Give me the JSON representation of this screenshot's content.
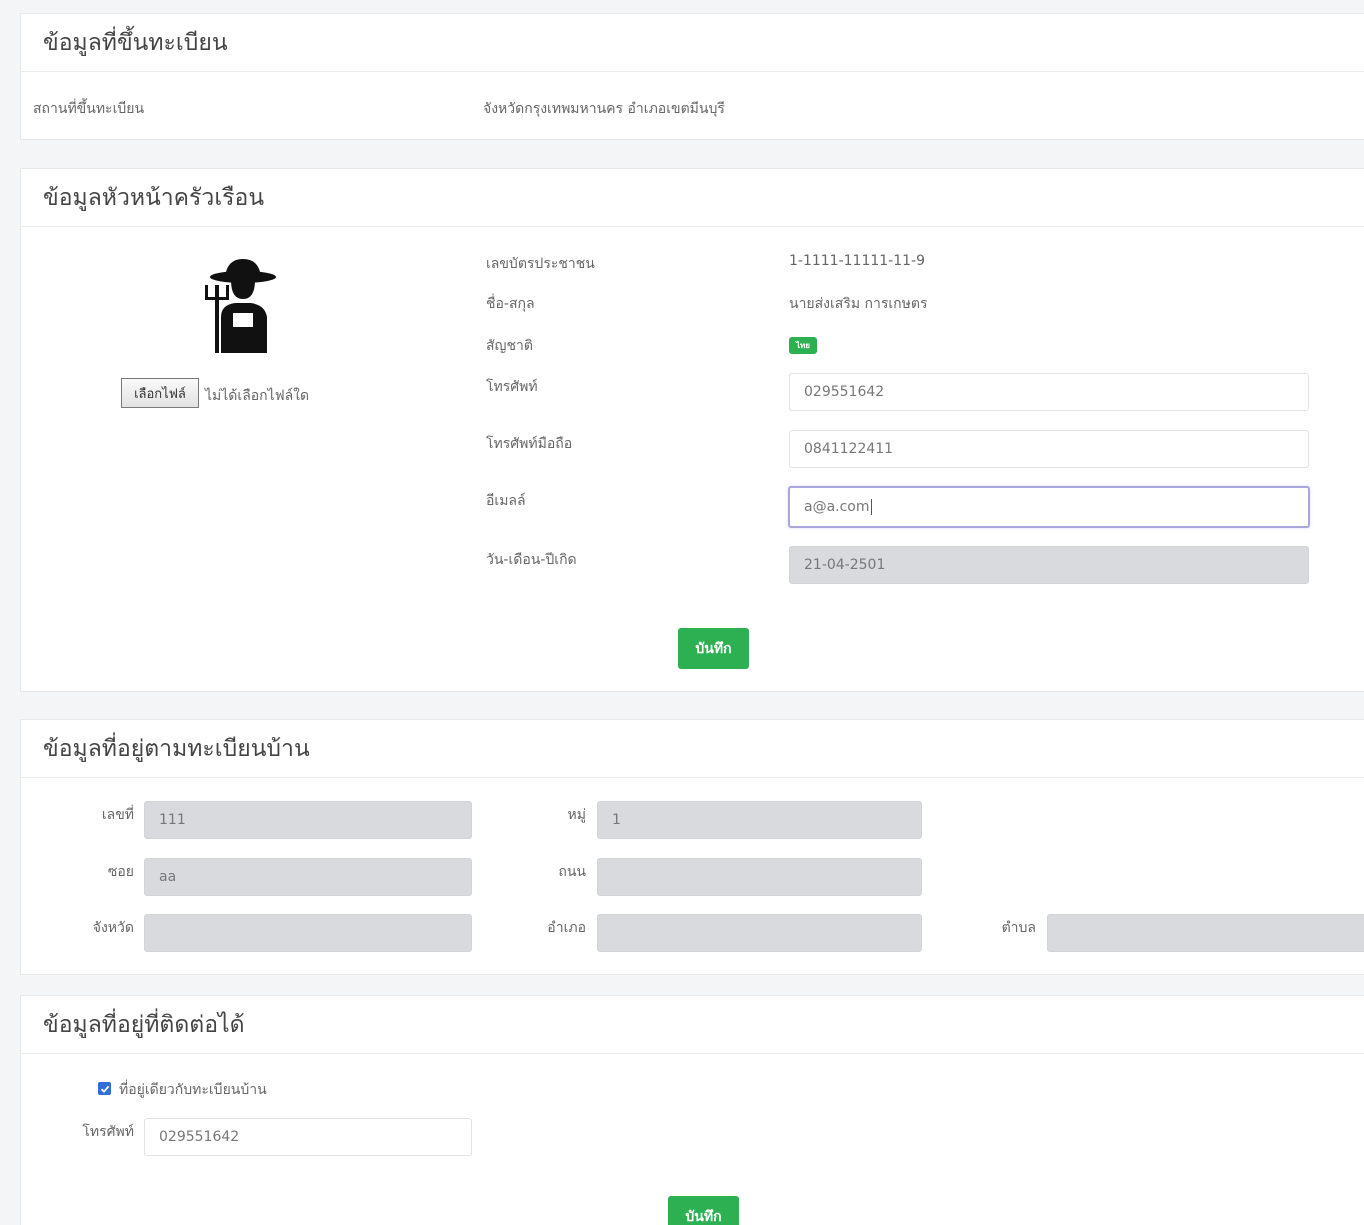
{
  "registration": {
    "title": "ข้อมูลที่ขึ้นทะเบียน",
    "place_label": "สถานที่ขึ้นทะเบียน",
    "place_value": "จังหวัดกรุงเทพมหานคร อำเภอเขตมีนบุรี"
  },
  "household_head": {
    "title": "ข้อมูลหัวหน้าครัวเรือน",
    "avatar_icon": "farmer-icon",
    "file_button": "เลือกไฟล์",
    "file_status": "ไม่ได้เลือกไฟล์ใด",
    "id_label": "เลขบัตรประชาชน",
    "id_value": "1-1111-11111-11-9",
    "name_label": "ชื่อ-สกุล",
    "name_value": "นายส่งเสริม การเกษตร",
    "nationality_label": "สัญชาติ",
    "nationality_badge": "ไทย",
    "phone_label": "โทรศัพท์",
    "phone_value": "029551642",
    "mobile_label": "โทรศัพท์มือถือ",
    "mobile_value": "0841122411",
    "email_label": "อีเมลล์",
    "email_value": "a@a.com",
    "dob_label": "วัน-เดือน-ปีเกิด",
    "dob_value": "21-04-2501",
    "save_button": "บันทึก"
  },
  "house_address": {
    "title": "ข้อมูลที่อยู่ตามทะเบียนบ้าน",
    "house_no_label": "เลขที่",
    "house_no_value": "111",
    "moo_label": "หมู่",
    "moo_value": "1",
    "soi_label": "ซอย",
    "soi_value": "aa",
    "road_label": "ถนน",
    "road_value": "",
    "province_label": "จังหวัด",
    "province_value": "",
    "district_label": "อำเภอ",
    "district_value": "",
    "subdistrict_label": "ตำบล",
    "subdistrict_value": ""
  },
  "contact_address": {
    "title": "ข้อมูลที่อยู่ที่ติดต่อได้",
    "same_as_house_label": "ที่อยู่เดียวกับทะเบียนบ้าน",
    "same_as_house_checked": true,
    "phone_label": "โทรศัพท์",
    "phone_value": "029551642",
    "save_button": "บันทึก"
  },
  "colors": {
    "accent_green": "#2db052",
    "checkbox_blue": "#2f6fd6",
    "focus_border": "#a9a6dc"
  }
}
